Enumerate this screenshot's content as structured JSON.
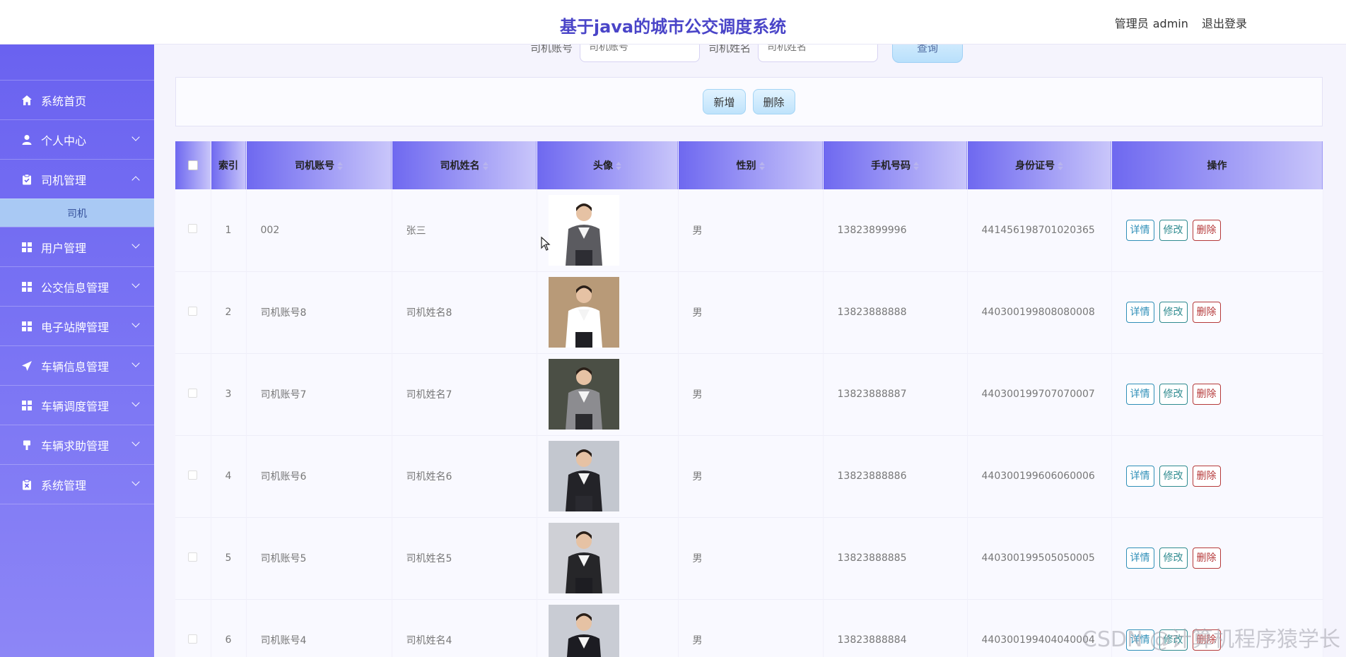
{
  "header": {
    "title": "基于java的城市公交调度系统",
    "user_role": "管理员",
    "user_name": "admin",
    "logout": "退出登录"
  },
  "sidebar": {
    "items": [
      {
        "label": "系统首页",
        "icon": "home-icon"
      },
      {
        "label": "个人中心",
        "icon": "user-icon"
      },
      {
        "label": "司机管理",
        "icon": "clipboard-icon",
        "expanded": true,
        "sub": "司机"
      },
      {
        "label": "用户管理",
        "icon": "grid-icon"
      },
      {
        "label": "公交信息管理",
        "icon": "grid-icon"
      },
      {
        "label": "电子站牌管理",
        "icon": "grid-icon"
      },
      {
        "label": "车辆信息管理",
        "icon": "send-icon"
      },
      {
        "label": "车辆调度管理",
        "icon": "grid-icon"
      },
      {
        "label": "车辆求助管理",
        "icon": "pin-icon"
      },
      {
        "label": "系统管理",
        "icon": "clipboard-x-icon"
      }
    ]
  },
  "search": {
    "account_label": "司机账号",
    "account_placeholder": "司机账号",
    "name_label": "司机姓名",
    "name_placeholder": "司机姓名",
    "query_button": "查询"
  },
  "actions": {
    "add": "新增",
    "delete": "删除"
  },
  "table": {
    "headers": {
      "index": "索引",
      "account": "司机账号",
      "name": "司机姓名",
      "avatar": "头像",
      "gender": "性别",
      "phone": "手机号码",
      "idcard": "身份证号",
      "ops": "操作"
    },
    "op_labels": {
      "detail": "详情",
      "edit": "修改",
      "delete": "删除"
    },
    "rows": [
      {
        "index": "1",
        "account": "002",
        "name": "张三",
        "gender": "男",
        "phone": "13823899996",
        "idcard": "441456198701020365",
        "avatar_colors": [
          "#ffffff",
          "#5b5b60",
          "#2d2d33"
        ]
      },
      {
        "index": "2",
        "account": "司机账号8",
        "name": "司机姓名8",
        "gender": "男",
        "phone": "13823888888",
        "idcard": "440300199808080008",
        "avatar_colors": [
          "#b89a78",
          "#ffffff",
          "#1f1f24"
        ]
      },
      {
        "index": "3",
        "account": "司机账号7",
        "name": "司机姓名7",
        "gender": "男",
        "phone": "13823888887",
        "idcard": "440300199707070007",
        "avatar_colors": [
          "#4b4f45",
          "#8c8c90",
          "#2b2b2e"
        ]
      },
      {
        "index": "4",
        "account": "司机账号6",
        "name": "司机姓名6",
        "gender": "男",
        "phone": "13823888886",
        "idcard": "440300199606060006",
        "avatar_colors": [
          "#c3c7cf",
          "#232328",
          "#2a2a30"
        ]
      },
      {
        "index": "5",
        "account": "司机账号5",
        "name": "司机姓名5",
        "gender": "男",
        "phone": "13823888885",
        "idcard": "440300199505050005",
        "avatar_colors": [
          "#cfd0d6",
          "#262629",
          "#1d1d22"
        ]
      },
      {
        "index": "6",
        "account": "司机账号4",
        "name": "司机姓名4",
        "gender": "男",
        "phone": "13823888884",
        "idcard": "440300199404040004",
        "avatar_colors": [
          "#c9ccd4",
          "#1c1c22",
          "#151518"
        ]
      }
    ]
  },
  "watermark": "CSDN @计算机程序猿学长"
}
